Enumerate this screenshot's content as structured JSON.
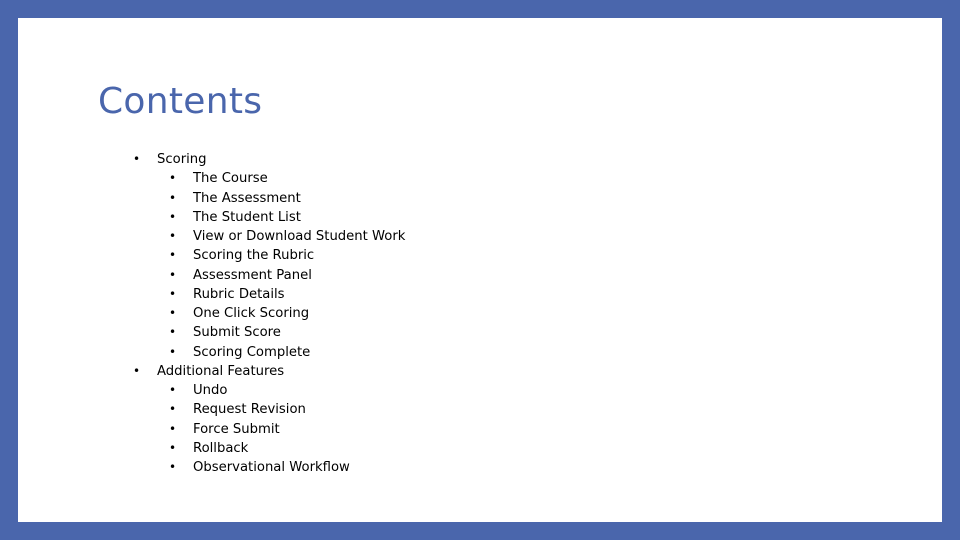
{
  "slide": {
    "title": "Contents",
    "accent_color": "#4a66ac",
    "bullet_glyph": "•",
    "sections": [
      {
        "label": "Scoring",
        "items": [
          "The Course",
          "The Assessment",
          "The Student List",
          "View or Download Student Work",
          "Scoring the Rubric",
          "Assessment Panel",
          "Rubric Details",
          "One Click Scoring",
          "Submit Score",
          "Scoring Complete"
        ]
      },
      {
        "label": "Additional Features",
        "items": [
          "Undo",
          "Request Revision",
          "Force Submit",
          "Rollback",
          "Observational Workflow"
        ]
      }
    ]
  }
}
